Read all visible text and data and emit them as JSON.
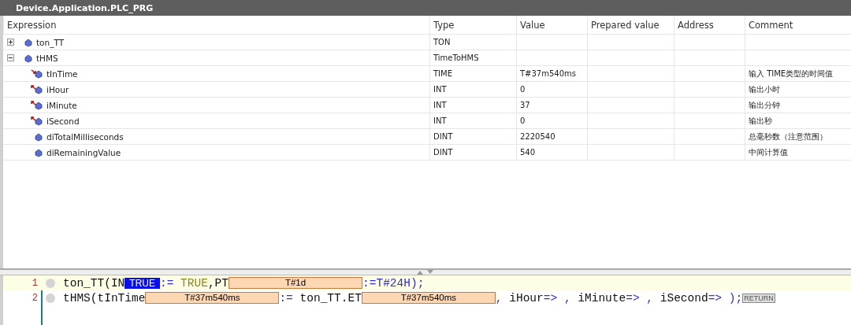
{
  "window": {
    "title": "Device.Application.PLC_PRG"
  },
  "table": {
    "columns": [
      "Expression",
      "Type",
      "Value",
      "Prepared value",
      "Address",
      "Comment"
    ],
    "rows": [
      {
        "expression": "ton_TT",
        "kind": "instance",
        "expanded": false,
        "type": "TON",
        "value": "",
        "comment": "",
        "children": []
      },
      {
        "expression": "tHMS",
        "kind": "instance",
        "expanded": true,
        "type": "TimeToHMS",
        "value": "",
        "comment": "",
        "children": [
          {
            "expression": "tInTime",
            "kind": "input",
            "type": "TIME",
            "value": "T#37m540ms",
            "comment": "输入 TIME类型的时间值"
          },
          {
            "expression": "iHour",
            "kind": "output",
            "type": "INT",
            "value": "0",
            "comment": "输出小时"
          },
          {
            "expression": "iMinute",
            "kind": "output",
            "type": "INT",
            "value": "37",
            "comment": "输出分钟"
          },
          {
            "expression": "iSecond",
            "kind": "output",
            "type": "INT",
            "value": "0",
            "comment": "输出秒"
          },
          {
            "expression": "diTotalMilliseconds",
            "kind": "local",
            "type": "DINT",
            "value": "2220540",
            "comment": "总毫秒数（注意范围）"
          },
          {
            "expression": "diRemainingValue",
            "kind": "local",
            "type": "DINT",
            "value": "540",
            "comment": "中间计算值"
          }
        ]
      }
    ]
  },
  "code": {
    "lines": [
      {
        "number": "1",
        "current": true,
        "segments": [
          {
            "kind": "text",
            "text": "ton_TT(IN"
          },
          {
            "kind": "bool-monitor",
            "text": "TRUE"
          },
          {
            "kind": "operator",
            "text": ":= "
          },
          {
            "kind": "literal",
            "text": "TRUE"
          },
          {
            "kind": "text",
            "text": ",PT"
          },
          {
            "kind": "monitor",
            "text": "T#1d"
          },
          {
            "kind": "operator",
            "text": ":=T#24H);"
          }
        ]
      },
      {
        "number": "2",
        "current": false,
        "segments": [
          {
            "kind": "text",
            "text": "tHMS(tInTime"
          },
          {
            "kind": "monitor",
            "text": "T#37m540ms"
          },
          {
            "kind": "operator",
            "text": ":= "
          },
          {
            "kind": "text",
            "text": "ton_TT.ET"
          },
          {
            "kind": "monitor",
            "text": "T#37m540ms"
          },
          {
            "kind": "operator",
            "text": ", "
          },
          {
            "kind": "text",
            "text": "iHour"
          },
          {
            "kind": "operator",
            "text": "=> , "
          },
          {
            "kind": "text",
            "text": "iMinute"
          },
          {
            "kind": "operator",
            "text": "=> , "
          },
          {
            "kind": "text",
            "text": "iSecond"
          },
          {
            "kind": "operator",
            "text": "=> );"
          },
          {
            "kind": "return",
            "text": "RETURN"
          }
        ]
      }
    ]
  }
}
